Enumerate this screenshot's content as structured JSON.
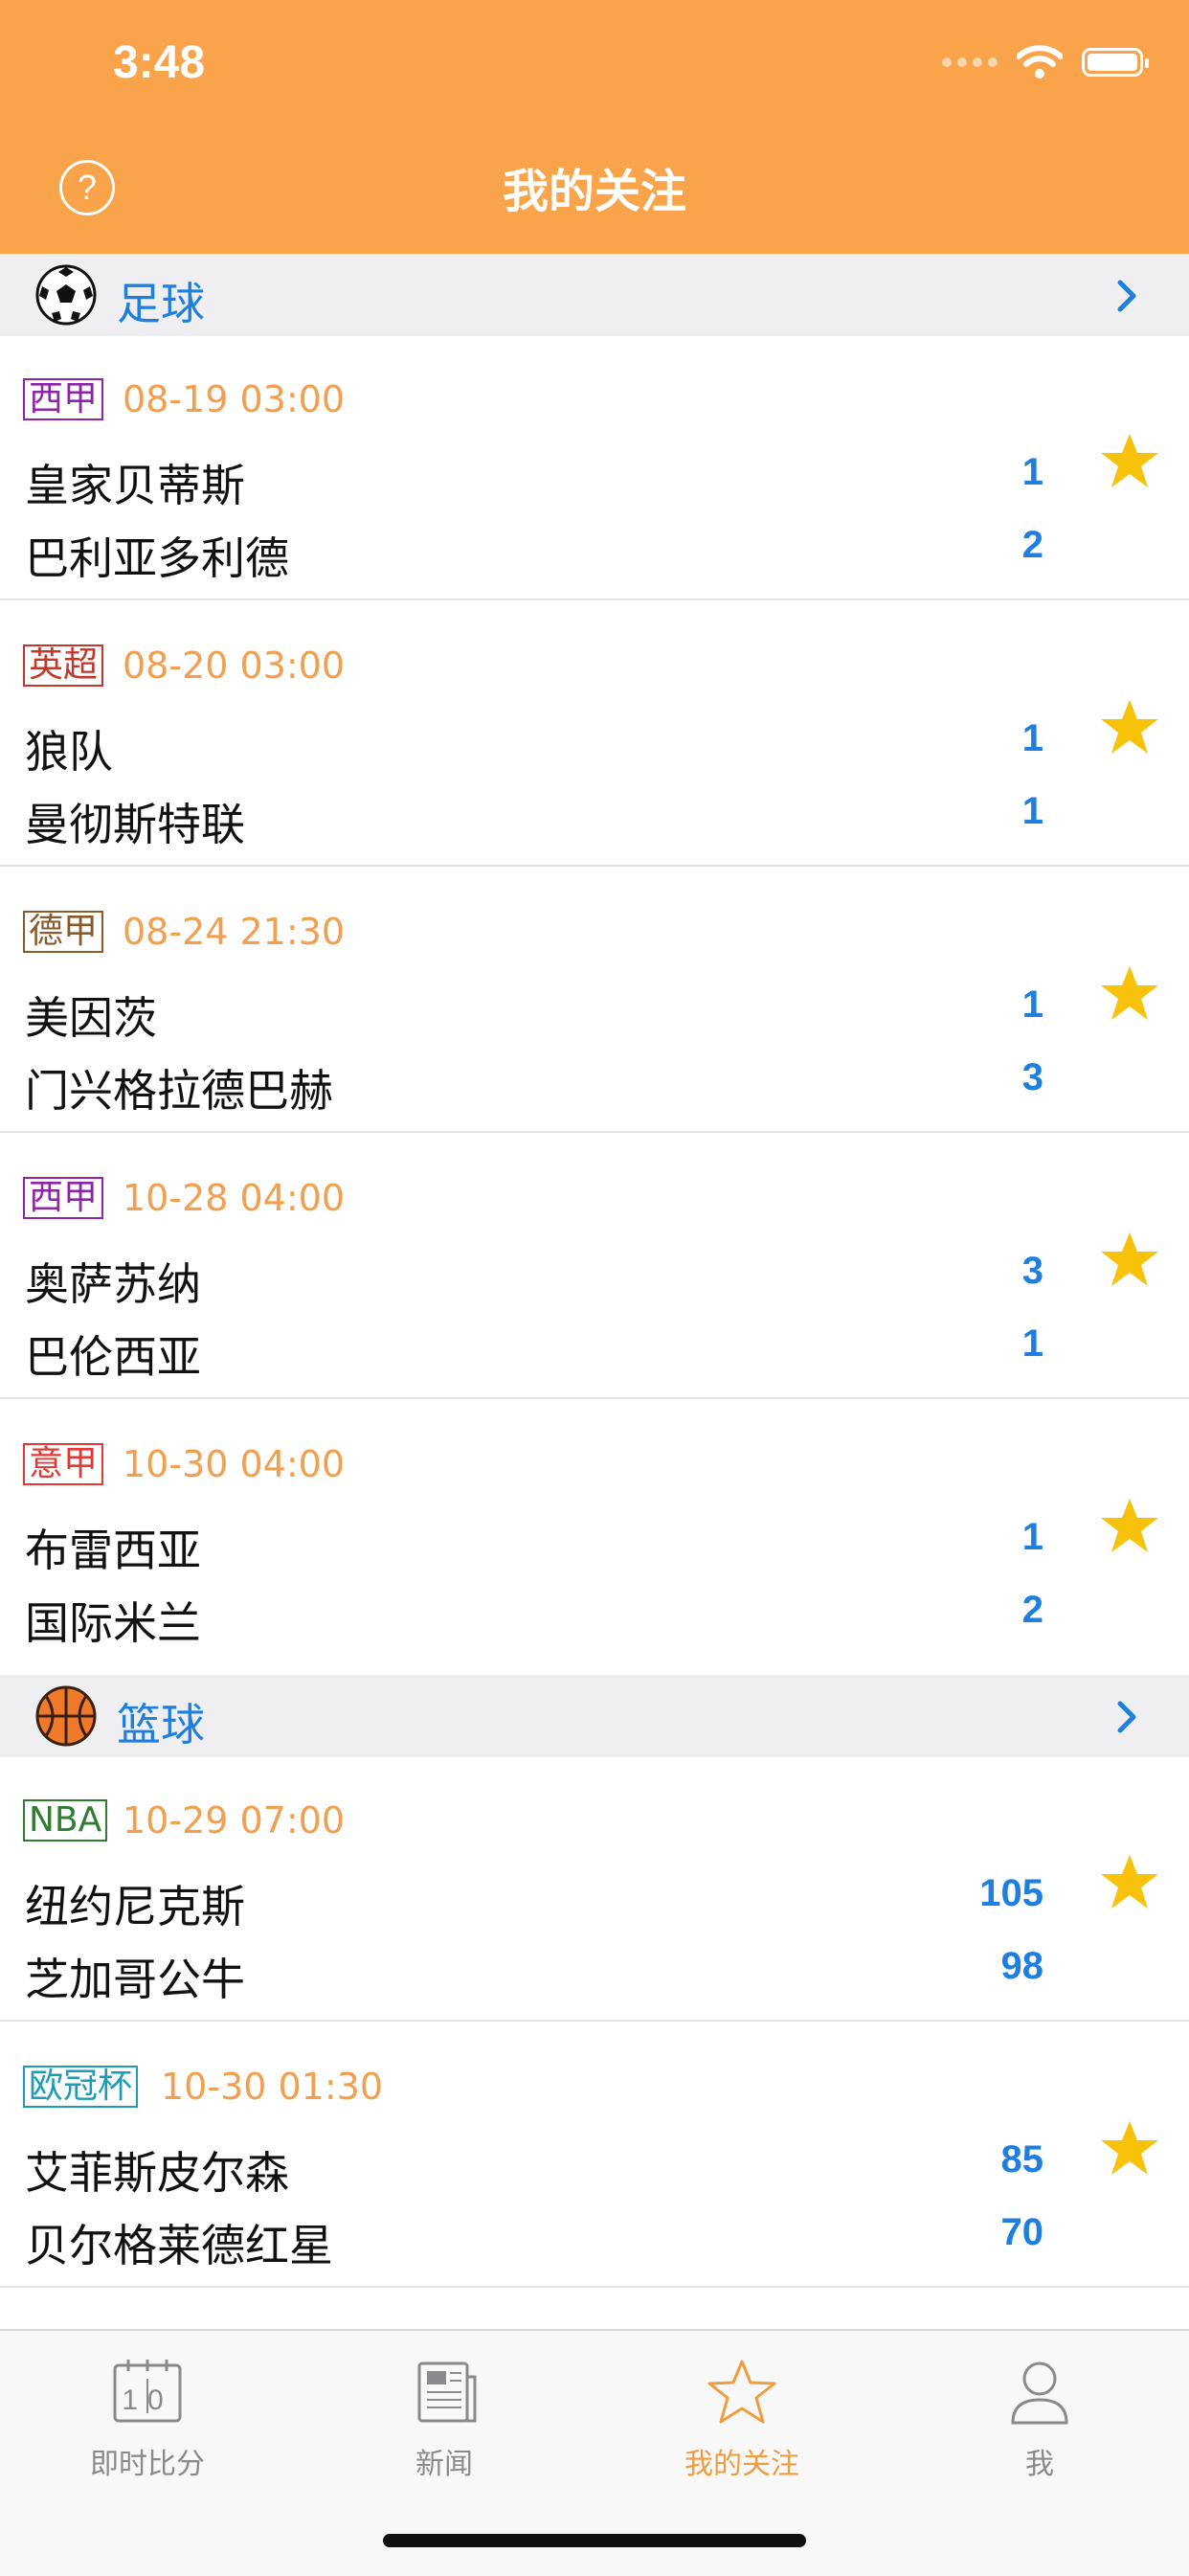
{
  "status": {
    "time": "3:48"
  },
  "header": {
    "title": "我的关注",
    "help_symbol": "?"
  },
  "colors": {
    "header_bg": "#F9A34B",
    "accent_blue": "#1F7FE0",
    "time_orange": "#F2A050",
    "star_yellow": "#F9C20A",
    "active_tab": "#F19C3F"
  },
  "sections": [
    {
      "title": "足球",
      "icon": "soccer-ball-icon",
      "matches": [
        {
          "league": "西甲",
          "league_color": "#8E24AA",
          "time": "08-19 03:00",
          "home": "皇家贝蒂斯",
          "away": "巴利亚多利德",
          "home_score": "1",
          "away_score": "2"
        },
        {
          "league": "英超",
          "league_color": "#C0392B",
          "time": "08-20 03:00",
          "home": "狼队",
          "away": "曼彻斯特联",
          "home_score": "1",
          "away_score": "1"
        },
        {
          "league": "德甲",
          "league_color": "#8B5A2B",
          "time": "08-24 21:30",
          "home": "美因茨",
          "away": "门兴格拉德巴赫",
          "home_score": "1",
          "away_score": "3"
        },
        {
          "league": "西甲",
          "league_color": "#8E24AA",
          "time": "10-28 04:00",
          "home": "奥萨苏纳",
          "away": "巴伦西亚",
          "home_score": "3",
          "away_score": "1"
        },
        {
          "league": "意甲",
          "league_color": "#E53935",
          "time": "10-30 04:00",
          "home": "布雷西亚",
          "away": "国际米兰",
          "home_score": "1",
          "away_score": "2"
        }
      ]
    },
    {
      "title": "篮球",
      "icon": "basketball-icon",
      "matches": [
        {
          "league": "NBA",
          "league_color": "#2E7D32",
          "time": "10-29 07:00",
          "home": "纽约尼克斯",
          "away": "芝加哥公牛",
          "home_score": "105",
          "away_score": "98"
        },
        {
          "league": "欧冠杯",
          "league_color": "#1E9BB5",
          "time": "10-30 01:30",
          "home": "艾菲斯皮尔森",
          "away": "贝尔格莱德红星",
          "home_score": "85",
          "away_score": "70"
        }
      ]
    }
  ],
  "tabbar": {
    "items": [
      {
        "label": "即时比分",
        "icon": "calendar-score-icon",
        "active": false
      },
      {
        "label": "新闻",
        "icon": "newspaper-icon",
        "active": false
      },
      {
        "label": "我的关注",
        "icon": "star-outline-icon",
        "active": true
      },
      {
        "label": "我",
        "icon": "person-icon",
        "active": false
      }
    ],
    "calendar_glyph": "10"
  }
}
